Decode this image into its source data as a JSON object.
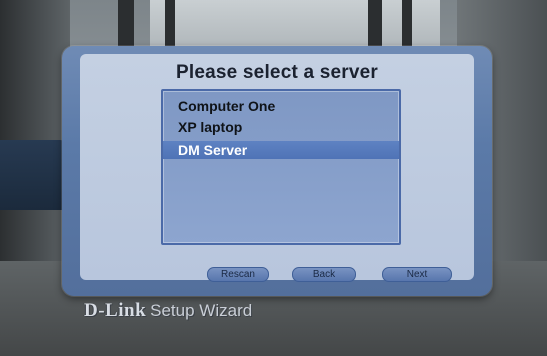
{
  "dialog": {
    "title": "Please select a server"
  },
  "server_list": {
    "items": [
      {
        "label": "Computer One",
        "selected": false
      },
      {
        "label": "XP laptop",
        "selected": false
      },
      {
        "label": "DM Server",
        "selected": true
      }
    ],
    "selected_index": 2
  },
  "buttons": {
    "rescan": "Rescan",
    "back": "Back",
    "next": "Next"
  },
  "branding": {
    "logo": "D-Link",
    "subtitle": "Setup Wizard"
  },
  "colors": {
    "panel_blue": "#5b7aa8",
    "list_blue": "#8da5cf",
    "selection_blue": "#4f73b6",
    "inner_panel": "#c4d0e2"
  }
}
